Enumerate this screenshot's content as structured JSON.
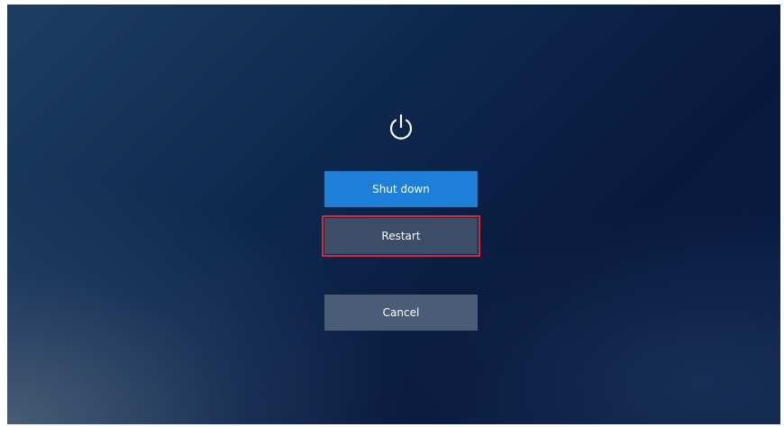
{
  "power_dialog": {
    "icon": "power-icon",
    "buttons": {
      "shutdown_label": "Shut down",
      "restart_label": "Restart",
      "cancel_label": "Cancel"
    }
  },
  "colors": {
    "primary_button": "#1e7fd8",
    "secondary_button": "#3c4d68",
    "highlight_border": "#d62a3a",
    "background_dark": "#08193c"
  }
}
